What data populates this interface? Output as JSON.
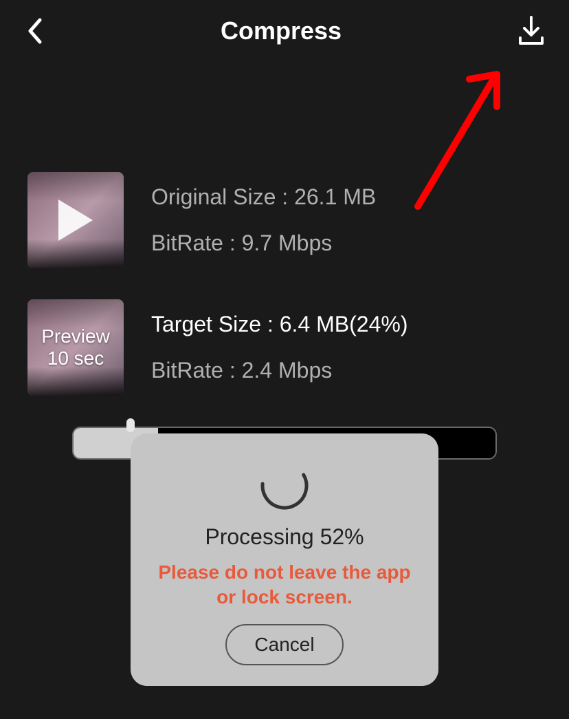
{
  "header": {
    "title": "Compress"
  },
  "original": {
    "size_label": "Original Size : 26.1 MB",
    "bitrate_label": "BitRate : 9.7 Mbps"
  },
  "target": {
    "size_label": "Target Size : 6.4 MB(24%)",
    "bitrate_label": "BitRate : 2.4 Mbps",
    "preview_label": "Preview",
    "preview_duration": "10 sec"
  },
  "slider": {
    "fill_percent": "20%"
  },
  "modal": {
    "processing_label": "Processing 52%",
    "warning_text": "Please do not leave the app or lock screen.",
    "cancel_label": "Cancel"
  }
}
